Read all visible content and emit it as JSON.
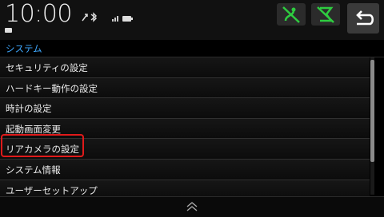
{
  "status": {
    "time": "10:00"
  },
  "header": {
    "breadcrumb": "システム"
  },
  "menu": {
    "items": [
      {
        "label": "セキュリティの設定"
      },
      {
        "label": "ハードキー動作の設定"
      },
      {
        "label": "時計の設定"
      },
      {
        "label": "起動画面変更"
      },
      {
        "label": "リアカメラの設定"
      },
      {
        "label": "システム情報"
      },
      {
        "label": "ユーザーセットアップ"
      }
    ],
    "highlighted_item": "リアカメラの設定"
  },
  "icons": {
    "nav_status": "route-off-icon",
    "mic_status": "voice-off-icon",
    "back": "back-arrow-icon",
    "scroll_up": "chevron-up-icon"
  },
  "colors": {
    "accent": "#3fa9ff",
    "status_green": "#2ecc40",
    "highlight": "#e01a1a"
  }
}
